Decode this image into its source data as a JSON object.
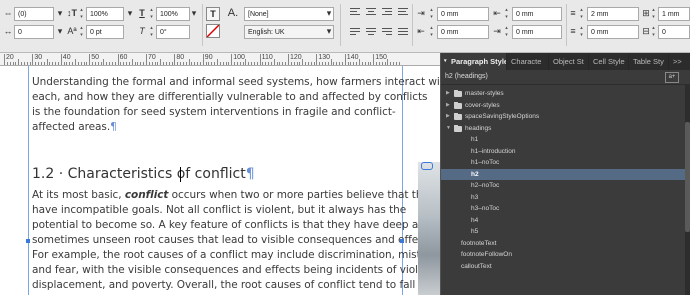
{
  "control_bar": {
    "row1": {
      "field_a": "(0)",
      "leading_scale": "100%",
      "horiz_scale": "100%",
      "char_style": "[None]",
      "indent_left": "0 mm",
      "indent_first": "0 mm",
      "space_before": "2 mm",
      "space_grid": "1 mm"
    },
    "row2": {
      "field_a": "0",
      "baseline_shift": "0 pt",
      "skew": "0°",
      "language": "English: UK",
      "indent_right": "0 mm",
      "indent_last": "0 mm",
      "space_after": "0 mm",
      "space_extra": "0"
    },
    "type_glyph": "T",
    "none_glyph": "A."
  },
  "ruler": {
    "labels": [
      "20",
      "30",
      "40",
      "50",
      "60",
      "70",
      "80",
      "90",
      "100",
      "110",
      "120",
      "130",
      "140",
      "150"
    ]
  },
  "document": {
    "para1": [
      "Understanding the formal and informal seed systems, how farmers interact with",
      "each, and how they are differentially vulnerable to and affected by conflicts",
      "is the foundation for seed system interventions in fragile and conflict-",
      "affected areas."
    ],
    "heading": "1.2 · Characteristics of conflict",
    "pilcrow": "¶",
    "para2_line1_pre": "At its most basic, ",
    "para2_line1_em": "conflict",
    "para2_line1_post": " occurs when two or more parties believe that they",
    "para2": [
      "have incompatible goals. Not all conflict is violent, but it always has the",
      "potential to become so. A key feature of conflicts is that they have deep and",
      "sometimes unseen root causes that lead to visible consequences and effects.",
      "For example, the root causes of a conflict may include discrimination, mistrust,",
      "and fear, with the visible consequences and effects being incidents of violence,",
      "displacement, and poverty. Overall, the root causes of conflict tend to fall into"
    ]
  },
  "panel": {
    "tabs": [
      "Paragraph Styles",
      "Characte",
      "Object St",
      "Cell Style",
      "Table Sty"
    ],
    "more": ">>",
    "current_style": "h2 (headings)",
    "items": [
      {
        "label": "master-styles",
        "type": "group",
        "expanded": false
      },
      {
        "label": "cover-styles",
        "type": "group",
        "expanded": false
      },
      {
        "label": "spaceSavingStyleOptions",
        "type": "group",
        "expanded": false
      },
      {
        "label": "headings",
        "type": "group",
        "expanded": true
      },
      {
        "label": "h1",
        "type": "style"
      },
      {
        "label": "h1–introduction",
        "type": "style"
      },
      {
        "label": "h1–noToc",
        "type": "style"
      },
      {
        "label": "h2",
        "type": "style",
        "selected": true
      },
      {
        "label": "h2–noToc",
        "type": "style"
      },
      {
        "label": "h3",
        "type": "style"
      },
      {
        "label": "h3–noToc",
        "type": "style"
      },
      {
        "label": "h4",
        "type": "style"
      },
      {
        "label": "h5",
        "type": "style"
      },
      {
        "label": "footnoteText",
        "type": "style-root"
      },
      {
        "label": "footnoteFollowOn",
        "type": "style-root"
      },
      {
        "label": "calloutText",
        "type": "style-root"
      }
    ]
  },
  "colors": {
    "selection": "#546a85",
    "guide": "#7aa7e0",
    "panel_bg": "#3b3b3b"
  }
}
